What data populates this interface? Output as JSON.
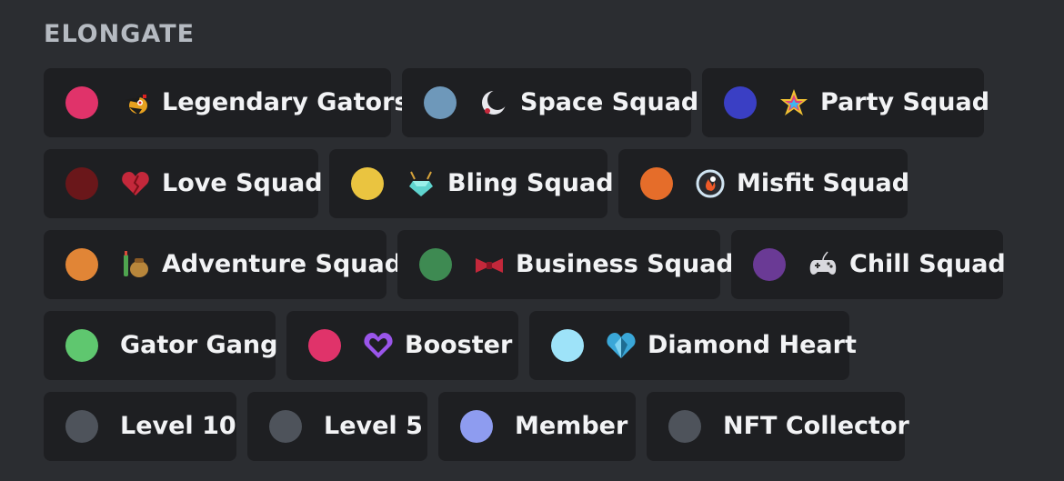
{
  "section": {
    "title": "ELONGATE"
  },
  "rows": [
    [
      {
        "label": "Legendary Gators",
        "color": "#e0336a",
        "icon": "gator-emoji-icon"
      },
      {
        "label": "Space Squad",
        "color": "#6e98ba",
        "icon": "crescent-moon-icon"
      },
      {
        "label": "Party Squad",
        "color": "#3a3fc4",
        "icon": "rainbow-star-icon"
      }
    ],
    [
      {
        "label": "Love Squad",
        "color": "#6a171a",
        "icon": "pixel-heart-icon"
      },
      {
        "label": "Bling Squad",
        "color": "#eac440",
        "icon": "diamond-necklace-icon"
      },
      {
        "label": "Misfit Squad",
        "color": "#e56d2a",
        "icon": "fire-orb-icon"
      }
    ],
    [
      {
        "label": "Adventure Squad",
        "color": "#e18536",
        "icon": "backpack-icon"
      },
      {
        "label": "Business Squad",
        "color": "#3e8a52",
        "icon": "bow-tie-icon"
      },
      {
        "label": "Chill Squad",
        "color": "#6a3a95",
        "icon": "game-controller-icon"
      }
    ],
    [
      {
        "label": "Gator Gang",
        "color": "#5fc76f",
        "icon": ""
      },
      {
        "label": "Booster",
        "color": "#e0336a",
        "icon": "purple-heart-icon"
      },
      {
        "label": "Diamond Heart",
        "color": "#9ee3f9",
        "icon": "diamond-heart-icon"
      }
    ],
    [
      {
        "label": "Level 10",
        "color": "#4e535b",
        "icon": ""
      },
      {
        "label": "Level 5",
        "color": "#4e535b",
        "icon": ""
      },
      {
        "label": "Member",
        "color": "#8e9cf0",
        "icon": ""
      },
      {
        "label": "NFT Collector",
        "color": "#4e535b",
        "icon": ""
      }
    ]
  ]
}
